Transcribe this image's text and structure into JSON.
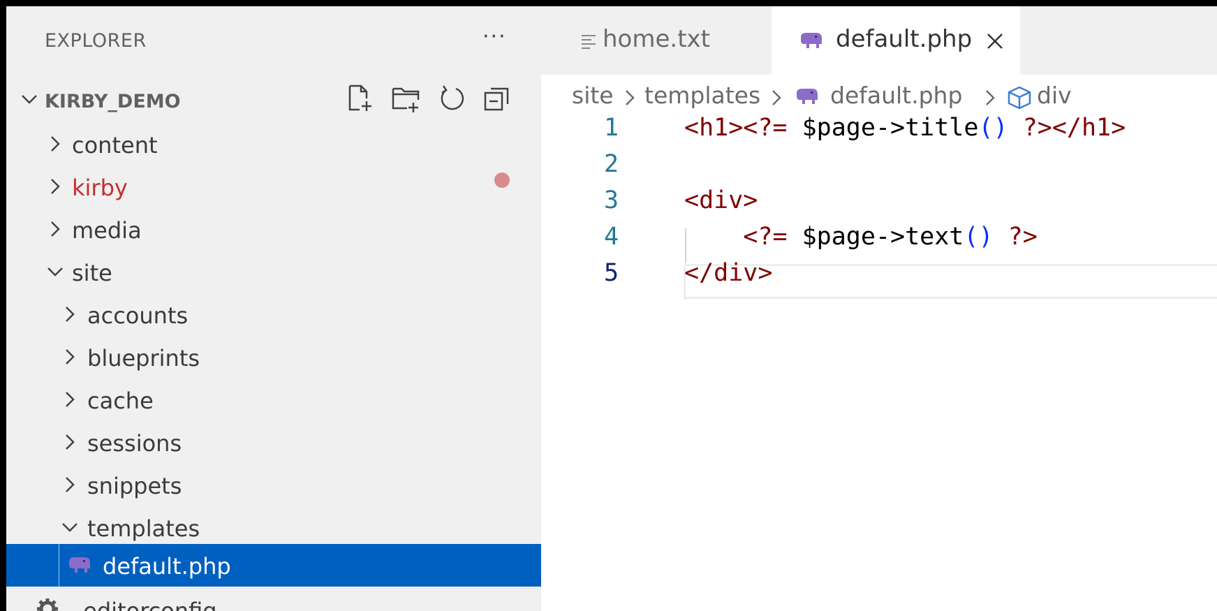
{
  "sidebar": {
    "header": "EXPLORER",
    "more": "···",
    "root": "KIRBY_DEMO",
    "toolbar": [
      "new-file-icon",
      "new-folder-icon",
      "refresh-icon",
      "collapse-all-icon"
    ],
    "items": [
      {
        "label": "content",
        "expanded": false,
        "depth": 0
      },
      {
        "label": "kirby",
        "expanded": false,
        "depth": 0,
        "modified": true,
        "color": "#c72e2e"
      },
      {
        "label": "media",
        "expanded": false,
        "depth": 0
      },
      {
        "label": "site",
        "expanded": true,
        "depth": 0
      },
      {
        "label": "accounts",
        "expanded": false,
        "depth": 1
      },
      {
        "label": "blueprints",
        "expanded": false,
        "depth": 1
      },
      {
        "label": "cache",
        "expanded": false,
        "depth": 1
      },
      {
        "label": "sessions",
        "expanded": false,
        "depth": 1
      },
      {
        "label": "snippets",
        "expanded": false,
        "depth": 1
      },
      {
        "label": "templates",
        "expanded": true,
        "depth": 1
      },
      {
        "label": "default.php",
        "depth": 2,
        "selected": true,
        "icon": "php-elephant-icon"
      },
      {
        "label": ".editorconfig",
        "depth": 0,
        "icon": "gear-icon"
      }
    ]
  },
  "tabs": [
    {
      "label": "home.txt",
      "icon": "text-file-icon",
      "active": false
    },
    {
      "label": "default.php",
      "icon": "php-elephant-icon",
      "active": true
    }
  ],
  "breadcrumb": [
    "site",
    "templates",
    "default.php",
    "div"
  ],
  "editor": {
    "lines": [
      {
        "n": "1",
        "parts": [
          [
            "tag",
            "<h1><?="
          ],
          [
            "var",
            " $page->title"
          ],
          [
            "paren",
            "()"
          ],
          [
            "tag",
            " ?></h1>"
          ]
        ]
      },
      {
        "n": "2",
        "parts": []
      },
      {
        "n": "3",
        "parts": [
          [
            "tag",
            "<div>"
          ]
        ]
      },
      {
        "n": "4",
        "parts": [
          [
            "var",
            "    "
          ],
          [
            "tag",
            "<?="
          ],
          [
            "var",
            " $page->text"
          ],
          [
            "paren",
            "()"
          ],
          [
            "tag",
            " ?>"
          ]
        ]
      },
      {
        "n": "5",
        "parts": [
          [
            "tag",
            "</div>"
          ]
        ],
        "active": true
      }
    ]
  },
  "colors": {
    "selection": "#0060c0",
    "modified_text": "#c72e2e",
    "modified_dot": "#d88b8b",
    "php_icon": "#8c6cc8"
  }
}
